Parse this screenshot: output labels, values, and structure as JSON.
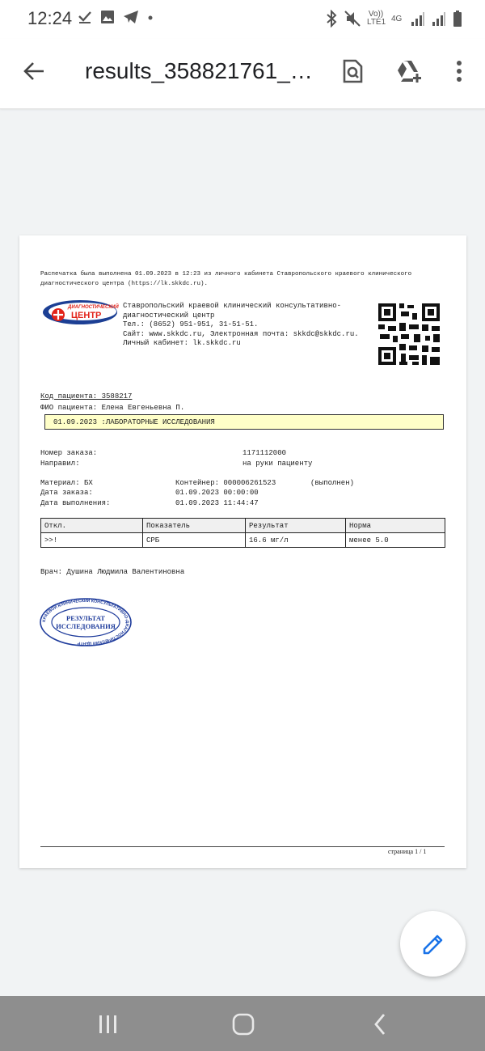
{
  "status_bar": {
    "time": "12:24",
    "left_icons": [
      "download-done-icon",
      "image-icon",
      "telegram-icon",
      "dot-icon"
    ],
    "right_icons": [
      "bluetooth-icon",
      "mute-icon",
      "volte-icon",
      "4g-icon",
      "signal-icon",
      "signal-roaming-icon",
      "battery-icon"
    ],
    "volte_label": "Vo)) LTE1",
    "network_label": "4G"
  },
  "app_bar": {
    "title": "results_358821761_0...",
    "icons": [
      "back-arrow-icon",
      "find-in-page-icon",
      "add-to-drive-icon",
      "more-vert-icon"
    ]
  },
  "document": {
    "print_note": "Распечатка была выполнена  01.09.2023 в 12:23 из личного кабинета Ставропольского краевого клинического диагностического центра (https://lk.skkdc.ru).",
    "logo": {
      "line1": "ДИАГНОСТИЧЕСКИЙ",
      "line2": "ЦЕНТР"
    },
    "clinic": {
      "name_line1": "Ставропольский краевой клинический консультативно-",
      "name_line2": "диагностический центр",
      "phone": "Тел.: (8652) 951-951, 31-51-51.",
      "site": "Сайт: www.skkdc.ru, Электронная почта: skkdc@skkdc.ru.",
      "cabinet": "Личный кабинет: lk.skkdc.ru"
    },
    "patient": {
      "code": "Код пациента: 3588217",
      "name": "ФИО пациента: Елена Евгеньевна П."
    },
    "banner": "01.09.2023 :ЛАБОРАТОРНЫЕ ИССЛЕДОВАНИЯ",
    "order": {
      "number_label": "Номер заказа:",
      "number_value": "1171112000",
      "sent_label": "Направил:",
      "sent_value": "на руки пациенту"
    },
    "material": {
      "material": "Материал: БХ",
      "container": "Контейнер: 000006261523",
      "status": "(выполнен)",
      "order_date_label": "Дата заказа:",
      "order_date_value": "01.09.2023 00:00:00",
      "done_date_label": "Дата выполнения:",
      "done_date_value": "01.09.2023 11:44:47"
    },
    "table": {
      "headers": [
        "Откл.",
        "Показатель",
        "Результат",
        "Норма"
      ],
      "rows": [
        [
          ">>!",
          "СРБ",
          "16.6 мг/л",
          "менее 5.0"
        ]
      ]
    },
    "doctor": "Врач: Душина Людмила Валентиновна",
    "stamp": {
      "center": "РЕЗУЛЬТАТ ИССЛЕДОВАНИЯ",
      "center_line1": "РЕЗУЛЬТАТ",
      "center_line2": "ИССЛЕДОВАНИЯ",
      "ring_text": "КРАЕВОЙ КЛИНИЧЕСКИЙ КОНСУЛЬТАТИВНО-ДИАГНОСТИЧЕСКИЙ ЦЕНТР"
    },
    "page_number": "страница 1 / 1"
  },
  "fab": {
    "icon": "edit-pencil-icon"
  },
  "nav_bar": {
    "icons": [
      "recents-icon",
      "home-icon",
      "back-icon"
    ]
  },
  "colors": {
    "accent": "#1a73e8",
    "banner": "#ffffc8",
    "logo_red": "#e2231a",
    "logo_blue": "#1c3f94",
    "stamp_blue": "#1f3c9c"
  }
}
